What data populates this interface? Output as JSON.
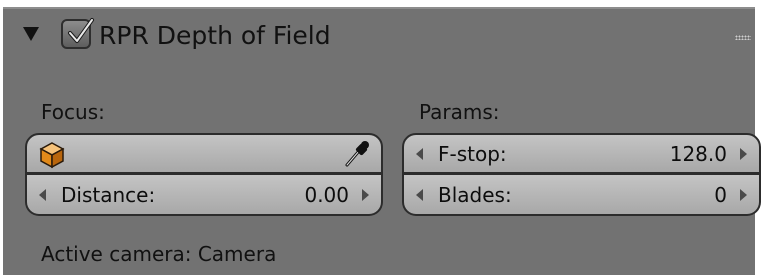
{
  "panel": {
    "title": "RPR Depth of Field",
    "enabled": true
  },
  "focus": {
    "label": "Focus:",
    "object_icon": "object-cube-icon",
    "picker_icon": "eyedropper-icon",
    "distance": {
      "label": "Distance:",
      "value": "0.00"
    },
    "active_camera_text": "Active camera: Camera"
  },
  "params": {
    "label": "Params:",
    "fstop": {
      "label": "F-stop:",
      "value": "128.0"
    },
    "blades": {
      "label": "Blades:",
      "value": "0"
    }
  },
  "colors": {
    "panel_bg": "#727272",
    "field_bg": "#b8b8b8",
    "text": "#111111"
  }
}
